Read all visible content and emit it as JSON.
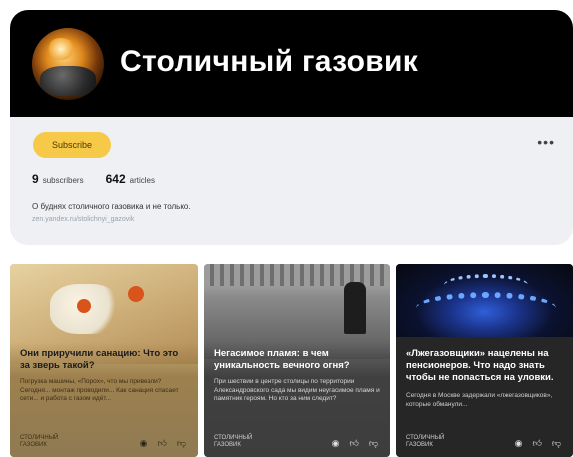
{
  "channel": {
    "title": "Столичный газовик",
    "subscribe_label": "Subscribe",
    "more_glyph": "•••",
    "stats": {
      "subscribers_value": "9",
      "subscribers_label": "subscribers",
      "articles_value": "642",
      "articles_label": "articles"
    },
    "description": "О буднях столичного газовика и не только.",
    "link": "zen.yandex.ru/stolichnyi_gazovik"
  },
  "articles": [
    {
      "title": "Они приручили санацию: Что это за зверь такой?",
      "snippet": "Погрузка машины, «Порох», что мы привезли? Сегодня... монтаж проводили... Как санация спасает сети... и работа с газом идёт...",
      "source": "СТОЛИЧНЫЙ ГАЗОВИК",
      "image_icon": "pipe-repair-photo"
    },
    {
      "title": "Негасимое пламя: в чем уникальность вечного огня?",
      "snippet": "При шествии в центре столицы по территории Александровского сада мы видим неугасимое пламя и памятник героям. Но кто за ним следит?",
      "source": "СТОЛИЧНЫЙ ГАЗОВИК",
      "image_icon": "eternal-flame-photo"
    },
    {
      "title": "«Лжегазовщики» нацелены на пенсионеров. Что надо знать чтобы не попасться на уловки.",
      "snippet": "Сегодня в Москве задержали «лжегазовщиков», которые обманули...",
      "source": "СТОЛИЧНЫЙ ГАЗОВИК",
      "image_icon": "gas-burner-photo"
    }
  ],
  "icons": {
    "views": "view-icon",
    "like": "thumbs-up-icon",
    "dislike": "thumbs-down-icon"
  },
  "colors": {
    "subscribe": "#f7c948",
    "header": "#000000",
    "card_bg": "#eef0f3"
  }
}
